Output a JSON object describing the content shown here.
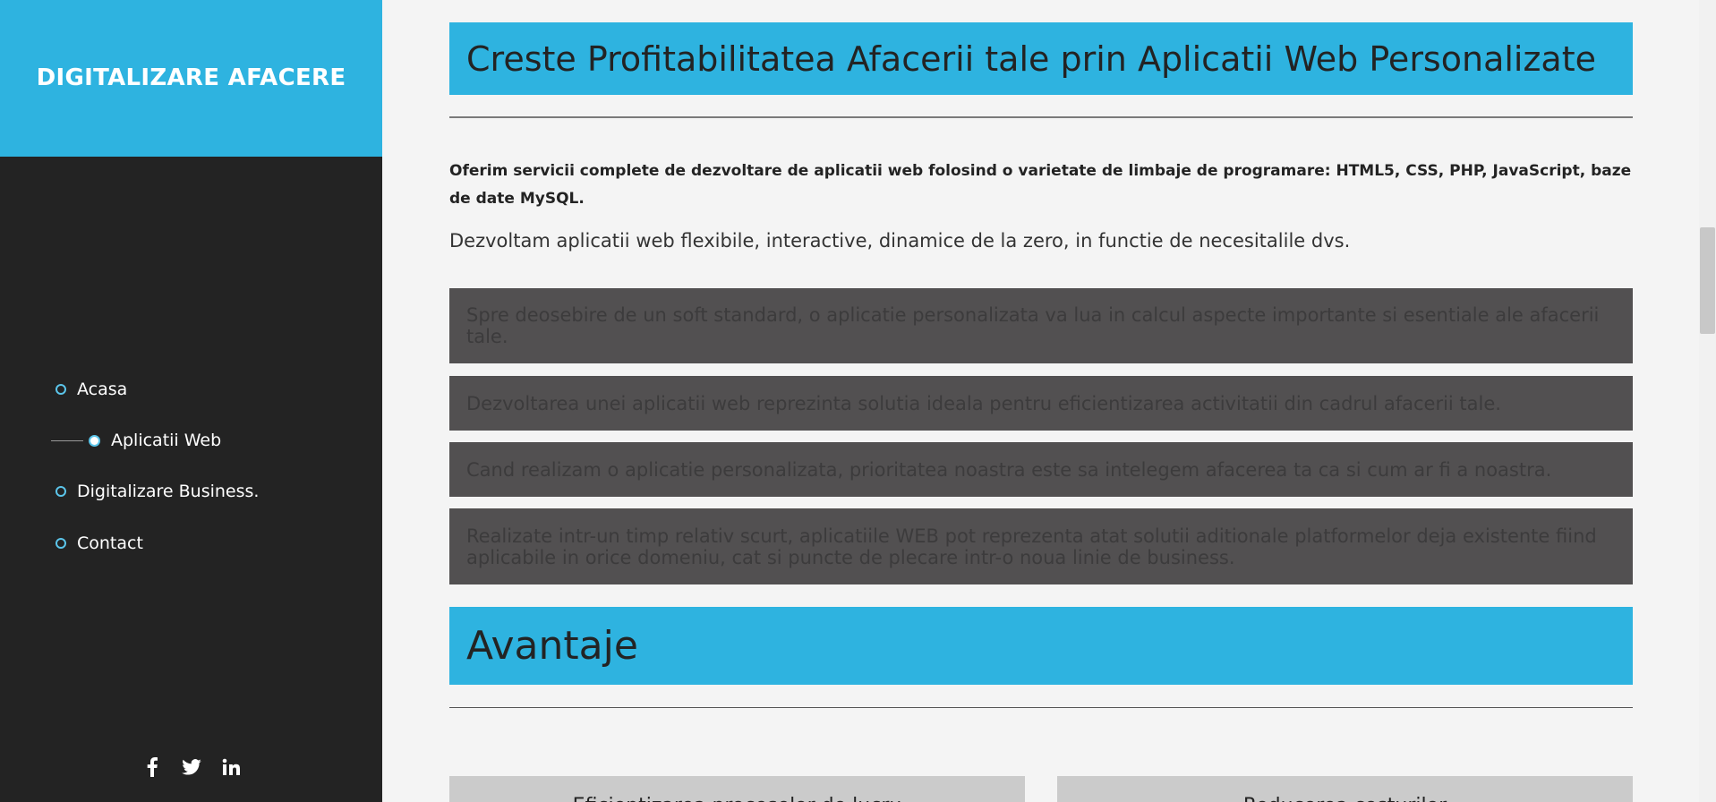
{
  "sidebar": {
    "brand": "DIGITALIZARE AFACERE",
    "nav": [
      {
        "label": "Acasa",
        "active": false
      },
      {
        "label": "Aplicatii Web",
        "active": true
      },
      {
        "label": "Digitalizare Business.",
        "active": false
      },
      {
        "label": "Contact",
        "active": false
      }
    ],
    "social": [
      {
        "icon": "facebook-icon"
      },
      {
        "icon": "twitter-icon"
      },
      {
        "icon": "linkedin-icon"
      }
    ]
  },
  "main": {
    "title": "Creste Profitabilitatea Afacerii tale prin Aplicatii Web Personalizate",
    "intro_bold": "Oferim servicii complete de dezvoltare de aplicatii web folosind o varietate de limbaje de programare: HTML5, CSS, PHP, JavaScript, baze de date MySQL.",
    "intro_text": "Dezvoltam aplicatii web flexibile, interactive, dinamice de la zero, in functie de necesitalile dvs.",
    "notes": [
      "Spre deosebire de un soft standard, o aplicatie personalizata va lua in calcul aspecte importante si esentiale ale afacerii tale.",
      "Dezvoltarea unei aplicatii web reprezinta solutia ideala pentru eficientizarea activitatii din cadrul afacerii tale.",
      "Cand realizam o aplicatie personalizata, prioritatea noastra este sa intelegem afacerea ta ca si cum ar fi a noastra.",
      "Realizate intr-un timp relativ scurt, aplicatiile WEB pot reprezenta atat solutii aditionale platformelor deja existente fiind aplicabile in orice domeniu, cat si puncte de plecare intr-o noua linie de business."
    ],
    "section_title": "Avantaje",
    "cards": [
      {
        "title": "Eficientizarea proceselor de lucru"
      },
      {
        "title": "Reducerea costurilor"
      }
    ]
  },
  "colors": {
    "accent": "#2eb3e0",
    "sidebar_bg": "#232323",
    "page_bg": "#f4f4f4",
    "note_bg": "#525051",
    "card_bg": "#cbcbcb"
  }
}
